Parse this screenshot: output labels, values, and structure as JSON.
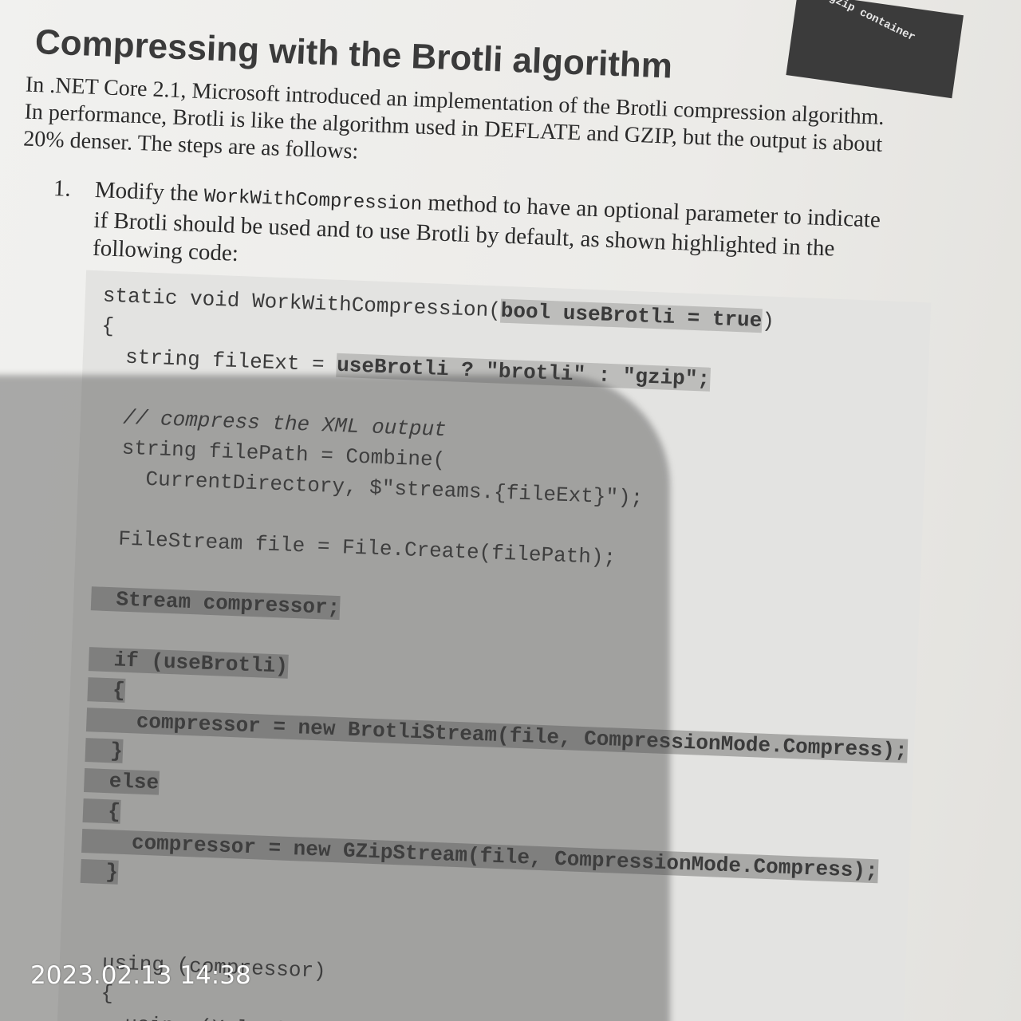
{
  "tab_text": ".gzip container",
  "title": "Compressing with the Brotli algorithm",
  "intro": [
    "In .NET Core 2.1, Microsoft introduced an implementation of the Brotli compression algorithm.",
    "In performance, Brotli is like the algorithm used in DEFLATE and GZIP, but the output is about",
    "20% denser. The steps are as follows:"
  ],
  "step": {
    "number": "1.",
    "line1_pre": "Modify the ",
    "line1_code": "WorkWithCompression",
    "line1_post": " method to have an optional parameter to indicate",
    "line2": "if Brotli should be used and to use Brotli by default, as shown highlighted in the",
    "line3": "following code:"
  },
  "code": [
    {
      "pre": "static void WorkWithCompression(",
      "hl": "bool useBrotli = true",
      "post": ")"
    },
    {
      "pre": "{",
      "hl": "",
      "post": ""
    },
    {
      "pre": "  string fileExt = ",
      "hl": "useBrotli ? \"brotli\" : \"gzip\";",
      "post": ""
    },
    {
      "pre": "",
      "hl": "",
      "post": ""
    },
    {
      "pre": "  ",
      "hl": "",
      "post": "",
      "comment": "// compress the XML output"
    },
    {
      "pre": "  string filePath = Combine(",
      "hl": "",
      "post": ""
    },
    {
      "pre": "    CurrentDirectory, $\"streams.{fileExt}\");",
      "hl": "",
      "post": ""
    },
    {
      "pre": "",
      "hl": "",
      "post": ""
    },
    {
      "pre": "  FileStream file = File.Create(filePath);",
      "hl": "",
      "post": ""
    },
    {
      "pre": "",
      "hl": "",
      "post": ""
    },
    {
      "pre": "",
      "hl": "  Stream compressor;",
      "post": ""
    },
    {
      "pre": "",
      "hl": "",
      "post": ""
    },
    {
      "pre": "",
      "hl": "  if (useBrotli)",
      "post": ""
    },
    {
      "pre": "",
      "hl": "  {",
      "post": ""
    },
    {
      "pre": "",
      "hl": "    compressor = new BrotliStream(file, CompressionMode.Compress);",
      "post": ""
    },
    {
      "pre": "",
      "hl": "  }",
      "post": ""
    },
    {
      "pre": "",
      "hl": "  else",
      "post": ""
    },
    {
      "pre": "",
      "hl": "  {",
      "post": ""
    },
    {
      "pre": "",
      "hl": "    compressor = new GZipStream(file, CompressionMode.Compress);",
      "post": ""
    },
    {
      "pre": "",
      "hl": "  }",
      "post": ""
    },
    {
      "pre": "",
      "hl": "",
      "post": ""
    },
    {
      "pre": "",
      "hl": "",
      "post": ""
    },
    {
      "pre": "  using (compressor)",
      "hl": "",
      "post": ""
    },
    {
      "pre": "  {",
      "hl": "",
      "post": ""
    },
    {
      "pre": "    using (XmlWriter xml = XmlWriter",
      "hl": "",
      "post": ""
    }
  ],
  "timestamp": "2023.02.13 14:38"
}
